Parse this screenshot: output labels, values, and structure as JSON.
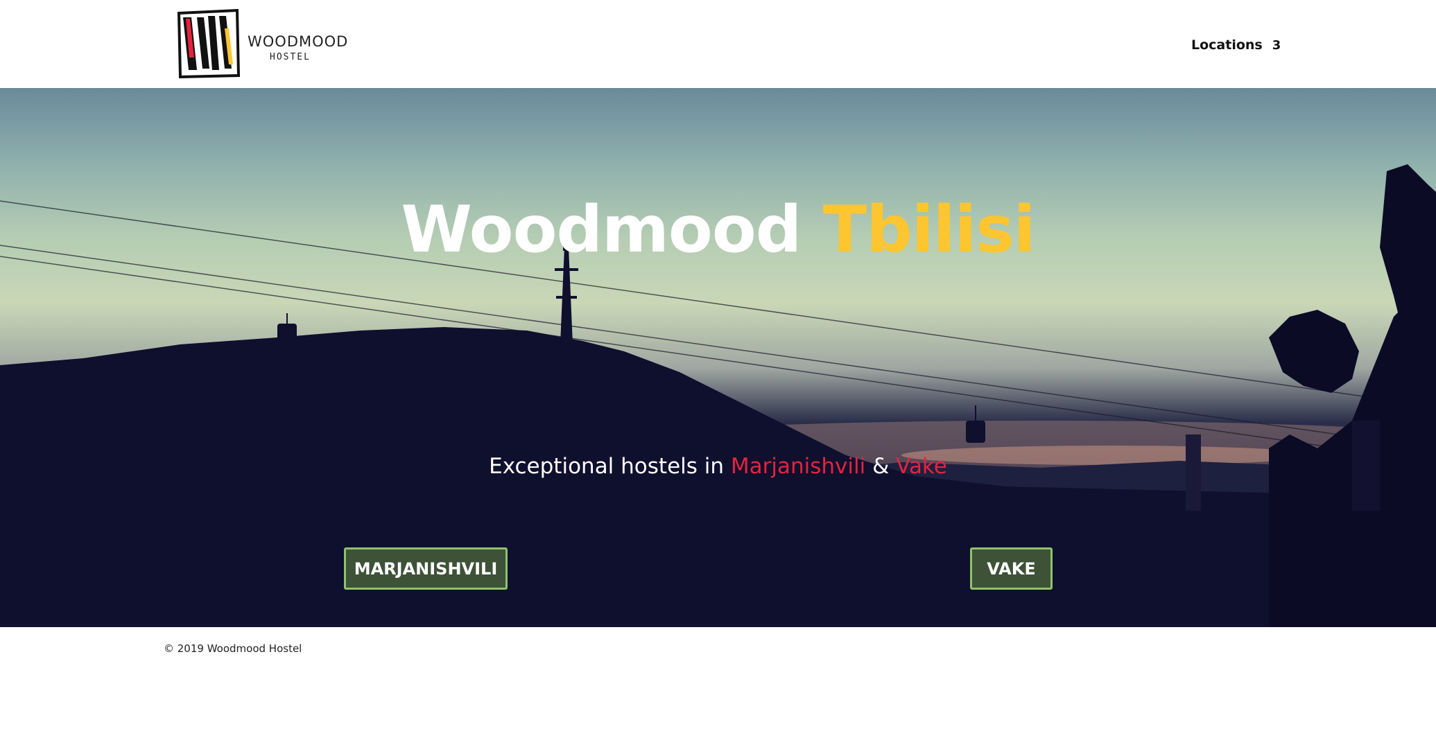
{
  "header": {
    "logo": {
      "title": "WOODMOOD",
      "subtitle": "HOSTEL",
      "colors": {
        "red": "#e5233d",
        "yellow": "#fdc530",
        "black": "#111111"
      }
    },
    "nav": {
      "locations_label": "Locations",
      "chevron_icon": "chevron-down-icon",
      "chevron_glyph": "3"
    }
  },
  "hero": {
    "title_main": "Woodmood",
    "title_accent": "Tbilisi",
    "subtitle_prefix": "Exceptional hostels in",
    "subtitle_location_1": "Marjanishvili",
    "subtitle_joiner": "&",
    "subtitle_location_2": "Vake",
    "buttons": {
      "marjanishvili": "MARJANISHVILI",
      "vake": "VAKE"
    },
    "colors": {
      "accent_yellow": "#fdc530",
      "accent_red": "#e5233d",
      "button_bg": "#3e5237",
      "button_border": "#8fc36a"
    }
  },
  "footer": {
    "copyright": "© 2019 Woodmood Hostel"
  }
}
